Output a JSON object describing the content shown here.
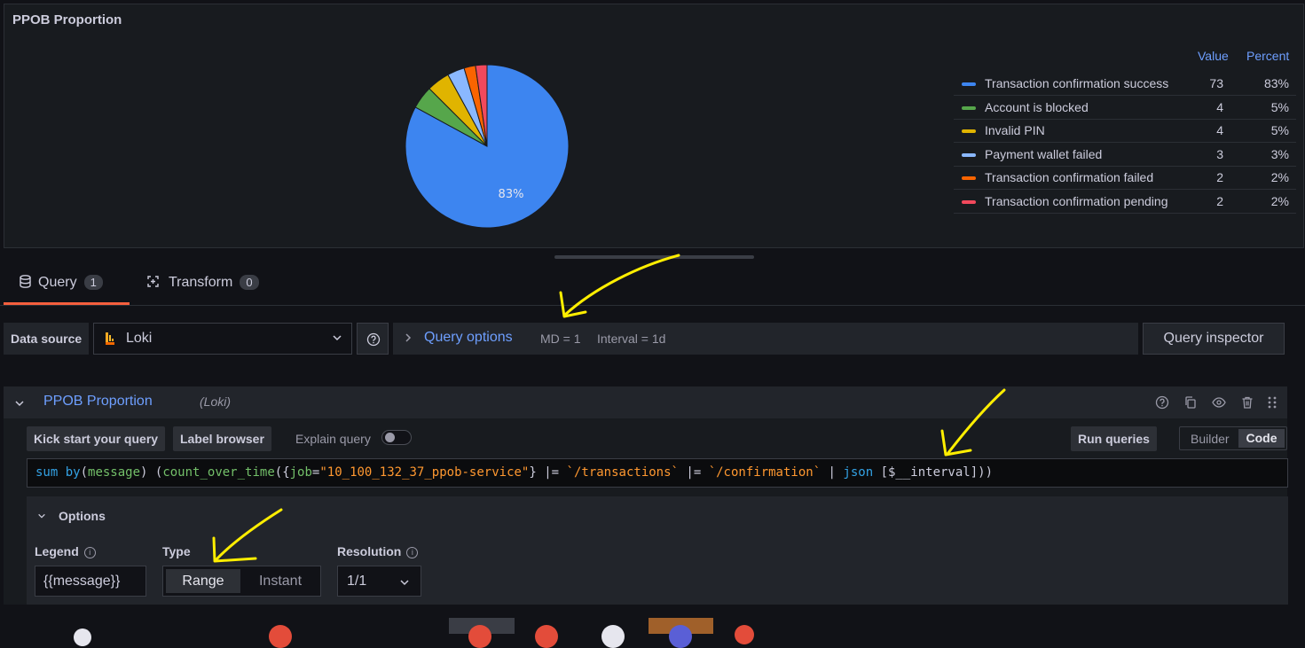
{
  "panel": {
    "title": "PPOB Proportion",
    "pie_center_label": "83%",
    "legend_headers": {
      "value": "Value",
      "percent": "Percent"
    },
    "legend": [
      {
        "name": "Transaction confirmation success",
        "value": "73",
        "percent": "83%",
        "color": "#3d85f0"
      },
      {
        "name": "Account is blocked",
        "value": "4",
        "percent": "5%",
        "color": "#56a64b"
      },
      {
        "name": "Invalid PIN",
        "value": "4",
        "percent": "5%",
        "color": "#e0b400"
      },
      {
        "name": "Payment wallet failed",
        "value": "3",
        "percent": "3%",
        "color": "#8ab8ff"
      },
      {
        "name": "Transaction confirmation failed",
        "value": "2",
        "percent": "2%",
        "color": "#fa6400"
      },
      {
        "name": "Transaction confirmation pending",
        "value": "2",
        "percent": "2%",
        "color": "#f2495c"
      }
    ]
  },
  "chart_data": {
    "type": "pie",
    "categories": [
      "Transaction confirmation success",
      "Account is blocked",
      "Invalid PIN",
      "Payment wallet failed",
      "Transaction confirmation failed",
      "Transaction confirmation pending"
    ],
    "values": [
      73,
      4,
      4,
      3,
      2,
      2
    ],
    "title": "PPOB Proportion",
    "legend_placement": "right"
  },
  "tabs": [
    {
      "label": "Query",
      "count": "1"
    },
    {
      "label": "Transform",
      "count": "0"
    }
  ],
  "toolbar": {
    "datasource_label": "Data source",
    "datasource_value": "Loki",
    "query_options_label": "Query options",
    "md": "MD = 1",
    "interval": "Interval = 1d",
    "query_inspector": "Query inspector"
  },
  "query": {
    "name": "PPOB Proportion",
    "datasource": "(Loki)",
    "kick_start": "Kick start your query",
    "label_browser": "Label browser",
    "explain_query": "Explain query",
    "run_queries": "Run queries",
    "builder": "Builder",
    "code_mode": "Code",
    "code": {
      "p1": "sum by",
      "p2": "(",
      "p3": "message",
      "p4": ") (",
      "p5": "count_over_time",
      "p6": "({",
      "p7": "job",
      "p8": "=",
      "p9": "\"10_100_132_37_ppob-service\"",
      "p10": "} |= ",
      "p11": "`/transactions`",
      "p12": " |= ",
      "p13": "`/confirmation`",
      "p14": " | ",
      "p15": "json",
      "p16": " [$__interval]))"
    }
  },
  "options": {
    "title": "Options",
    "legend_label": "Legend",
    "legend_value": "{{message}}",
    "type_label": "Type",
    "type_range": "Range",
    "type_instant": "Instant",
    "resolution_label": "Resolution",
    "resolution_value": "1/1"
  }
}
